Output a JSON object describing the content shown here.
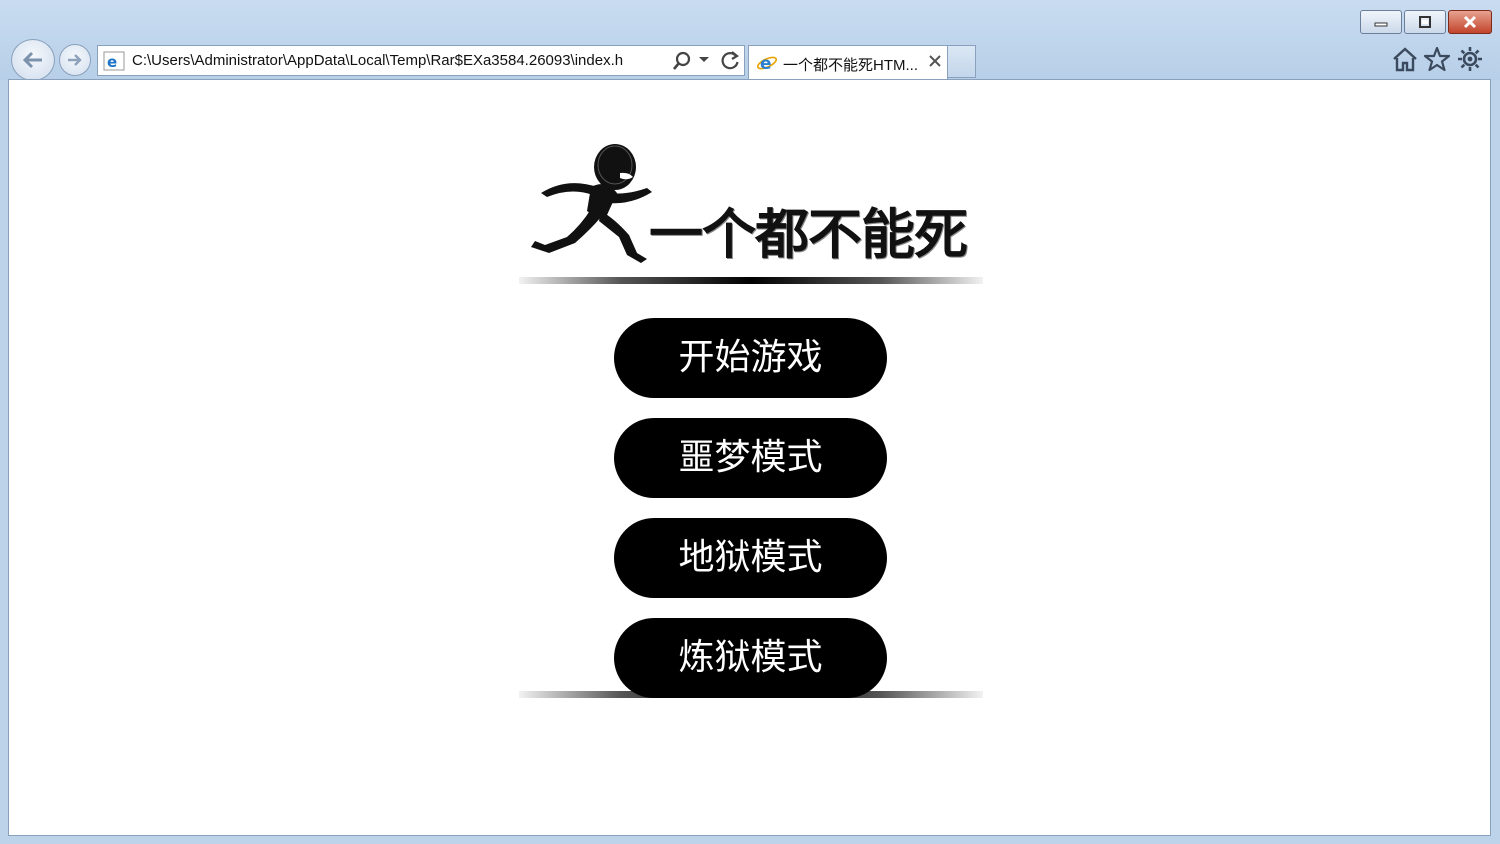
{
  "window": {
    "minimize_icon": "minimize-icon",
    "maximize_icon": "restore-icon",
    "close_icon": "close-icon"
  },
  "browser": {
    "address": "C:\\Users\\Administrator\\AppData\\Local\\Temp\\Rar$EXa3584.26093\\index.h",
    "tab_title": "一个都不能死HTM...",
    "tab_close_label": "×"
  },
  "game": {
    "title": "一个都不能死",
    "menu": [
      {
        "label": "开始游戏"
      },
      {
        "label": "噩梦模式"
      },
      {
        "label": "地狱模式"
      },
      {
        "label": "炼狱模式"
      }
    ]
  },
  "colors": {
    "button_bg": "#000000",
    "button_text": "#ffffff",
    "chrome_bg": "#bcd3ea"
  }
}
